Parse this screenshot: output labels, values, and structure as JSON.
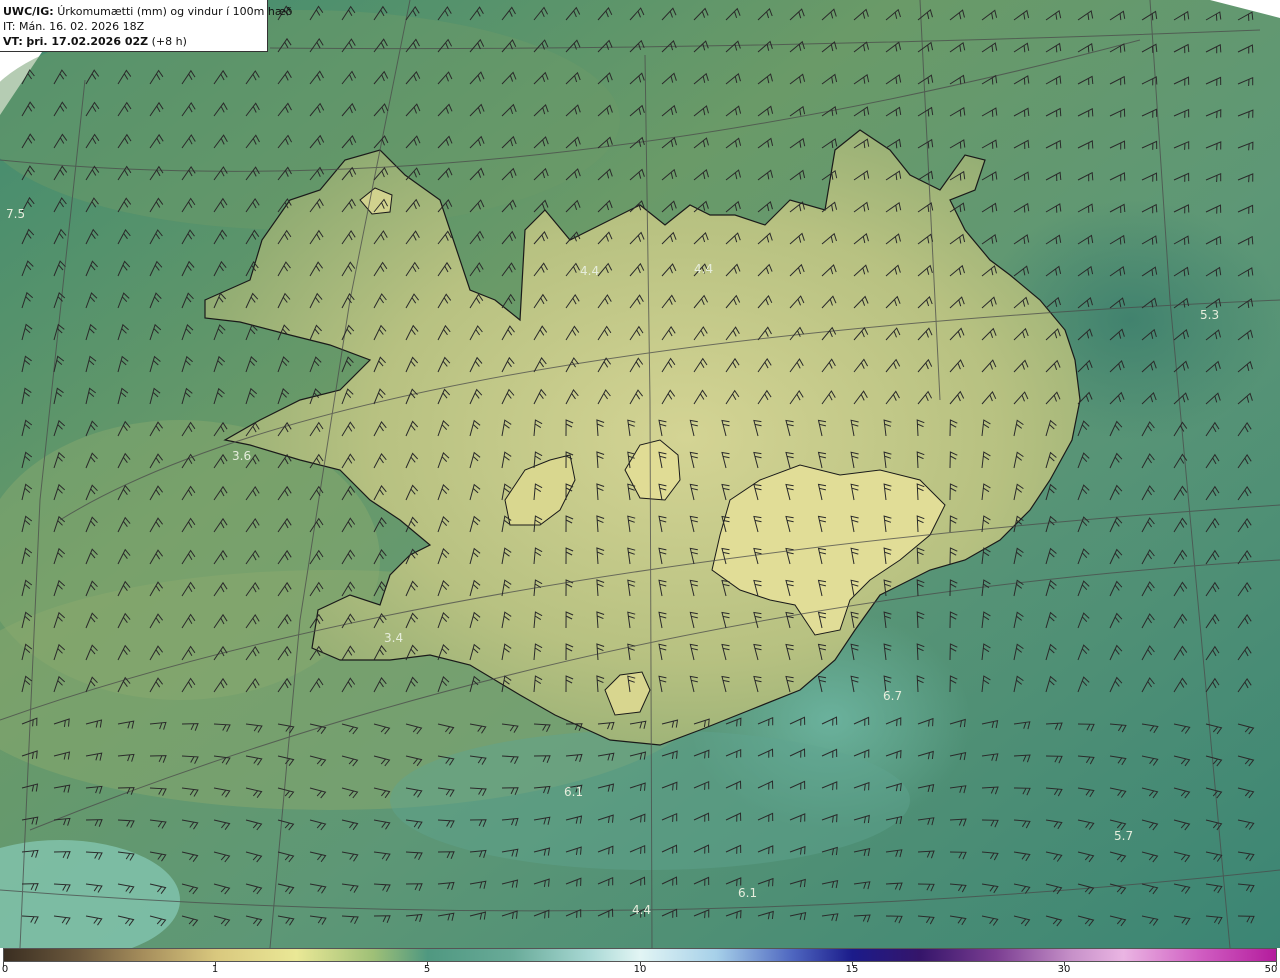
{
  "header": {
    "product": "UWC/IG:",
    "title": "Úrkomumætti (mm) og vindur í 100m hæð",
    "it_line": "IT: Mán. 16. 02. 2026 18Z",
    "vt_prefix": "VT:",
    "vt_value": "þri. 17.02.2026 02Z",
    "vt_suffix": "(+8 h)"
  },
  "map_labels": [
    {
      "text": "7.5"
    },
    {
      "text": "4.4"
    },
    {
      "text": "4.4"
    },
    {
      "text": "5.3"
    },
    {
      "text": "3.6"
    },
    {
      "text": "3.4"
    },
    {
      "text": "6.7"
    },
    {
      "text": "6.1"
    },
    {
      "text": "5.7"
    },
    {
      "text": "6.1"
    },
    {
      "text": "4.4"
    }
  ],
  "colorbar": {
    "ticks": [
      "0",
      "1",
      "5",
      "10",
      "15",
      "30",
      "50"
    ]
  },
  "colors": {
    "sea": "#4e8f7a",
    "land": "#bcc484",
    "coast": "#1a1a1a",
    "barb": "#2a2a2a",
    "grid": "#4a4a4a"
  }
}
